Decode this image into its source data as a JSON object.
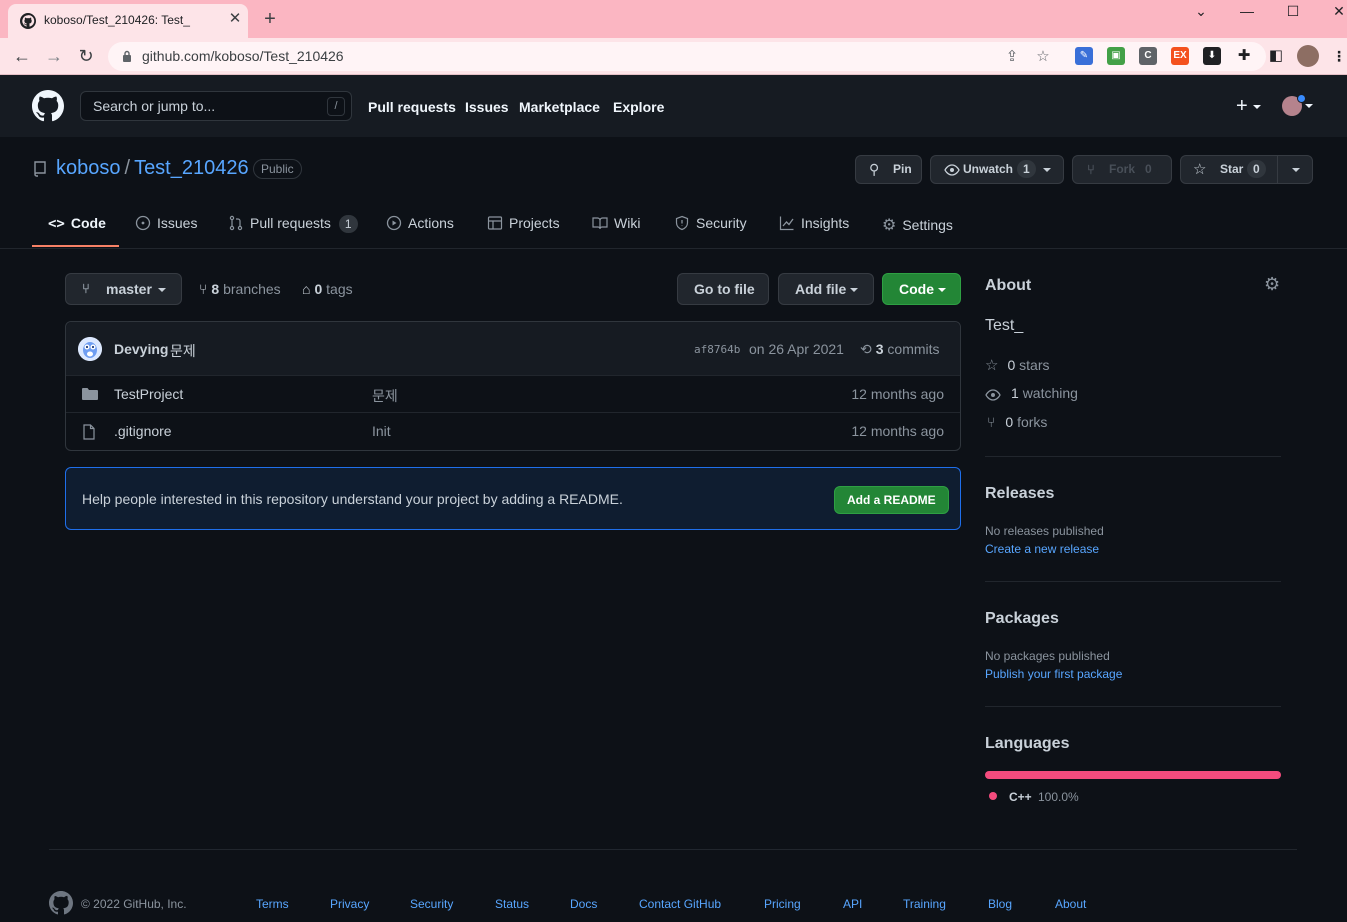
{
  "browser": {
    "tab_title": "koboso/Test_210426: Test_",
    "url": "github.com/koboso/Test_210426"
  },
  "header": {
    "search_placeholder": "Search or jump to...",
    "slash_key": "/",
    "nav": [
      "Pull requests",
      "Issues",
      "Marketplace",
      "Explore"
    ],
    "plus": "+"
  },
  "repo": {
    "owner": "koboso",
    "sep": "/",
    "name": "Test_210426",
    "visibility": "Public",
    "pin": "Pin",
    "unwatch": "Unwatch",
    "watch_count": "1",
    "fork": "Fork",
    "fork_count": "0",
    "star": "Star",
    "star_count": "0"
  },
  "tabs": {
    "code": "Code",
    "issues": "Issues",
    "pull_requests": "Pull requests",
    "pull_requests_count": "1",
    "actions": "Actions",
    "projects": "Projects",
    "wiki": "Wiki",
    "security": "Security",
    "insights": "Insights",
    "settings": "Settings"
  },
  "toolbar": {
    "branch": "master",
    "branches_count": "8",
    "branches_label": "branches",
    "tags_count": "0",
    "tags_label": "tags",
    "go_to_file": "Go to file",
    "add_file": "Add file",
    "code": "Code"
  },
  "commit": {
    "author": "Devying",
    "message": "문제",
    "sha": "af8764b",
    "date": "on 26 Apr 2021",
    "commits_count": "3",
    "commits_label": "commits"
  },
  "files": [
    {
      "name": "TestProject",
      "type": "folder",
      "message": "문제",
      "age": "12 months ago"
    },
    {
      "name": ".gitignore",
      "type": "file",
      "message": "Init",
      "age": "12 months ago"
    }
  ],
  "readme": {
    "text": "Help people interested in this repository understand your project by adding a README.",
    "button": "Add a README"
  },
  "about": {
    "heading": "About",
    "description": "Test_",
    "stars_count": "0",
    "stars_label": "stars",
    "watching_count": "1",
    "watching_label": "watching",
    "forks_count": "0",
    "forks_label": "forks"
  },
  "releases": {
    "heading": "Releases",
    "empty": "No releases published",
    "link": "Create a new release"
  },
  "packages": {
    "heading": "Packages",
    "empty": "No packages published",
    "link": "Publish your first package"
  },
  "languages": {
    "heading": "Languages",
    "items": [
      {
        "name": "C++",
        "percent": "100.0%",
        "color": "#f34b7d"
      }
    ]
  },
  "footer": {
    "copyright": "© 2022 GitHub, Inc.",
    "links": [
      "Terms",
      "Privacy",
      "Security",
      "Status",
      "Docs",
      "Contact GitHub",
      "Pricing",
      "API",
      "Training",
      "Blog",
      "About"
    ]
  },
  "colors": {
    "accent": "#58a6ff",
    "tab_underline": "#f78166",
    "green": "#238636",
    "browser_frame": "#fbb6c2"
  }
}
